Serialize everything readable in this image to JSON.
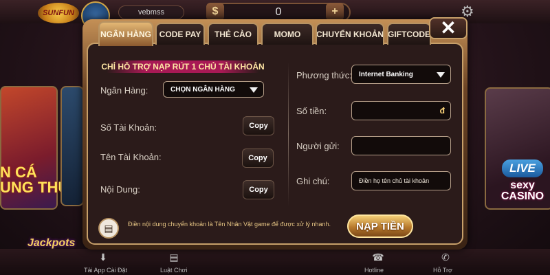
{
  "background": {
    "logo_text": "SUNFUN",
    "username": "vebmss",
    "balance": "0",
    "fish_game_text": "N CÁ\nUNG THU",
    "live_badge": "LIVE",
    "live_sub": "sexy\nCASINO",
    "jackpot": "Jackpots",
    "bottom_nav": [
      {
        "label": "Tải App Cài Đặt",
        "icon": "download-icon"
      },
      {
        "label": "Luật Chơi",
        "icon": "book-icon"
      },
      {
        "label": "Hotline",
        "icon": "phone-icon"
      },
      {
        "label": "Hỗ Trợ",
        "icon": "support-icon"
      }
    ]
  },
  "modal": {
    "close_label": "✕",
    "tabs": [
      {
        "label": "NGÂN HÀNG",
        "active": true
      },
      {
        "label": "CODE PAY",
        "active": false
      },
      {
        "label": "THẺ CÀO",
        "active": false
      },
      {
        "label": "MOMO",
        "active": false
      },
      {
        "label": "CHUYỂN KHOẢN",
        "active": false
      },
      {
        "label": "GIFTCODE",
        "active": false
      }
    ],
    "notice": "CHỈ HỖ TRỢ NẠP RÚT 1 CHỦ TÀI KHOẢN",
    "left": {
      "bank_label": "Ngân Hàng:",
      "bank_select": "CHỌN NGÂN HÀNG",
      "account_number_label": "Số Tài Khoản:",
      "account_name_label": "Tên Tài Khoản:",
      "content_label": "Nội Dung:",
      "copy_label": "Copy"
    },
    "right": {
      "method_label": "Phương thức:",
      "method_value": "Internet Banking",
      "amount_label": "Số tiền:",
      "amount_currency": "đ",
      "sender_label": "Người gửi:",
      "note_label": "Ghi chú:",
      "note_value": "Điền họ tên chủ tài khoản"
    },
    "footer_text": "Điền nội dung chuyển khoản là Tên Nhân Vật game để được xử lý nhanh.",
    "deposit_button": "NẠP TIỀN"
  }
}
